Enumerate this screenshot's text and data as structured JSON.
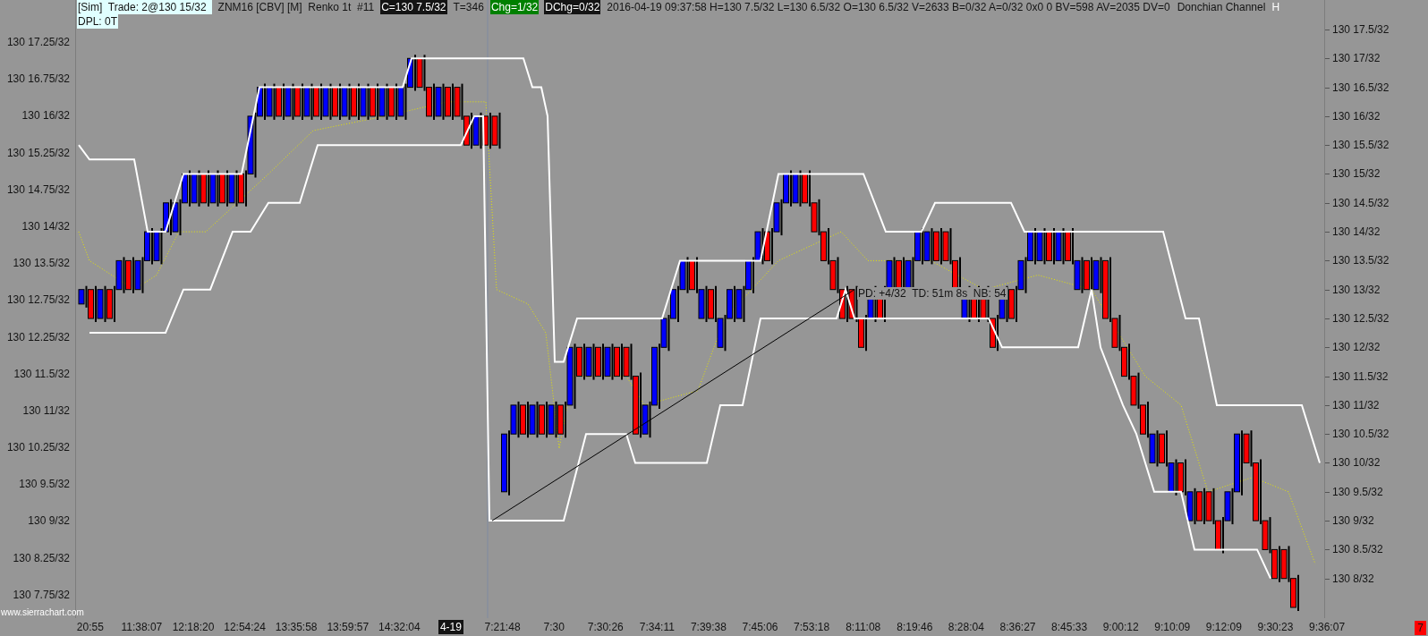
{
  "header": {
    "sim_label": "[Sim]  Trade: 2@130 15/32",
    "dpl": "DPL: 0T",
    "fields": [
      {
        "text": "ZNM16 [CBV] [M]  Renko 1t  #11",
        "kind": "plain"
      },
      {
        "text": "C=130 7.5/32",
        "kind": "dark"
      },
      {
        "text": "T=346",
        "kind": "plain"
      },
      {
        "text": "Chg=1/32",
        "kind": "green"
      },
      {
        "text": "DChg=0/32",
        "kind": "dark"
      },
      {
        "text": "2016-04-19 09:37:58 H=130 7.5/32 L=130 6.5/32 O=130 6.5/32 V=2633 B=0/32 A=0/32 0x0 0 BV=598 AV=2035 DV=0",
        "kind": "plain"
      },
      {
        "text": "Donchian Channel",
        "kind": "plain"
      }
    ],
    "cut_label": "H"
  },
  "left_axis": [
    "130 17.25/32",
    "130 16.75/32",
    "130 16/32",
    "130 15.25/32",
    "130 14.75/32",
    "130 14/32",
    "130 13.5/32",
    "130 12.75/32",
    "130 12.25/32",
    "130 11.5/32",
    "130 11/32",
    "130 10.25/32",
    "130 9.5/32",
    "130 9/32",
    "130 8.25/32",
    "130 7.75/32"
  ],
  "right_axis": [
    "130 17.5/32",
    "130 17/32",
    "130 16.5/32",
    "130 16/32",
    "130 15.5/32",
    "130 15/32",
    "130 14.5/32",
    "130 14/32",
    "130 13.5/32",
    "130 13/32",
    "130 12.5/32",
    "130 12/32",
    "130 11.5/32",
    "130 11/32",
    "130 10.5/32",
    "130 10/32",
    "130 9.5/32",
    "130 9/32",
    "130 8.5/32",
    "130 8/32"
  ],
  "time_axis": [
    {
      "text": "20:55",
      "highlighted": false
    },
    {
      "text": "11:38:07",
      "highlighted": false
    },
    {
      "text": "12:18:20",
      "highlighted": false
    },
    {
      "text": "12:54:24",
      "highlighted": false
    },
    {
      "text": "13:35:58",
      "highlighted": false
    },
    {
      "text": "13:59:57",
      "highlighted": false
    },
    {
      "text": "14:32:04",
      "highlighted": false
    },
    {
      "text": "4-19",
      "highlighted": true
    },
    {
      "text": "7:21:48",
      "highlighted": false
    },
    {
      "text": "7:30",
      "highlighted": false
    },
    {
      "text": "7:30:26",
      "highlighted": false
    },
    {
      "text": "7:34:11",
      "highlighted": false
    },
    {
      "text": "7:39:38",
      "highlighted": false
    },
    {
      "text": "7:45:06",
      "highlighted": false
    },
    {
      "text": "7:53:18",
      "highlighted": false
    },
    {
      "text": "8:11:08",
      "highlighted": false
    },
    {
      "text": "8:19:46",
      "highlighted": false
    },
    {
      "text": "8:28:04",
      "highlighted": false
    },
    {
      "text": "8:36:27",
      "highlighted": false
    },
    {
      "text": "8:45:33",
      "highlighted": false
    },
    {
      "text": "9:00:12",
      "highlighted": false
    },
    {
      "text": "9:10:09",
      "highlighted": false
    },
    {
      "text": "9:12:09",
      "highlighted": false
    },
    {
      "text": "9:30:23",
      "highlighted": false
    },
    {
      "text": "9:36:07",
      "highlighted": false
    }
  ],
  "annotation": "PD: +4/32  TD: 51m 8s  NB: 54",
  "watermark": "www.sierrachart.com",
  "alert_badge": "7"
}
